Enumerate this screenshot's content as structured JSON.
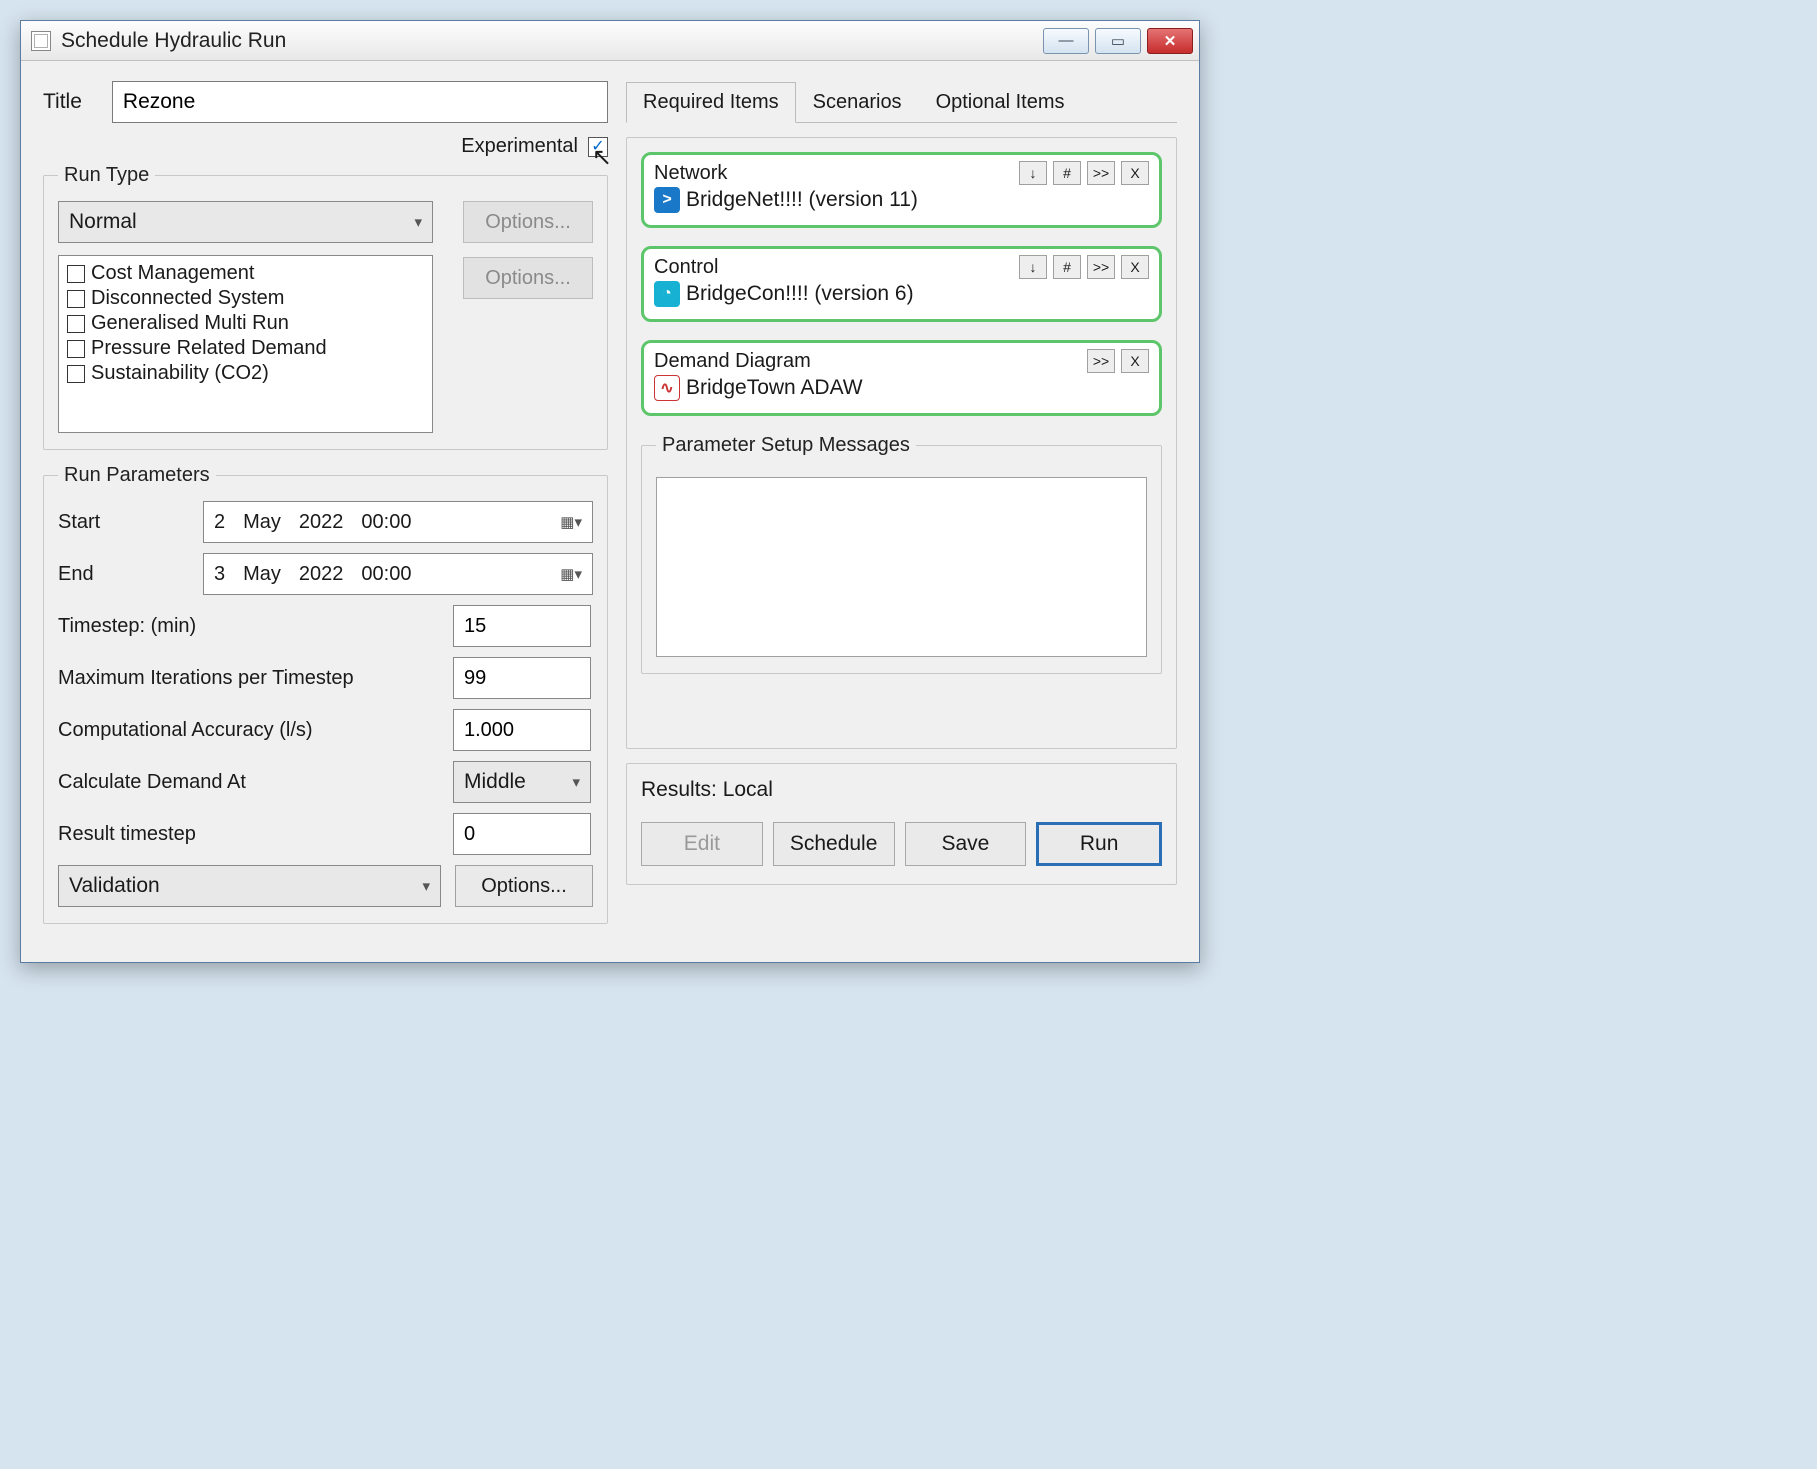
{
  "window": {
    "title": "Schedule Hydraulic Run"
  },
  "titleField": {
    "label": "Title",
    "value": "Rezone"
  },
  "experimental": {
    "label": "Experimental",
    "checked": true
  },
  "runType": {
    "legend": "Run Type",
    "value": "Normal",
    "options1": "Options...",
    "options2": "Options...",
    "checks": [
      "Cost Management",
      "Disconnected System",
      "Generalised Multi Run",
      "Pressure Related Demand",
      "Sustainability (CO2)"
    ]
  },
  "runParams": {
    "legend": "Run Parameters",
    "startLabel": "Start",
    "start": {
      "d": "2",
      "m": "May",
      "y": "2022",
      "t": "00:00"
    },
    "endLabel": "End",
    "end": {
      "d": "3",
      "m": "May",
      "y": "2022",
      "t": "00:00"
    },
    "timestepLabel": "Timestep: (min)",
    "timestep": "15",
    "maxIterLabel": "Maximum Iterations per Timestep",
    "maxIter": "99",
    "accuracyLabel": "Computational Accuracy (l/s)",
    "accuracy": "1.000",
    "calcAtLabel": "Calculate Demand At",
    "calcAt": "Middle",
    "resultTsLabel": "Result timestep",
    "resultTs": "0",
    "validation": "Validation",
    "options3": "Options..."
  },
  "tabs": {
    "t1": "Required Items",
    "t2": "Scenarios",
    "t3": "Optional Items"
  },
  "items": {
    "network": {
      "label": "Network",
      "value": "BridgeNet!!!! (version 11)"
    },
    "control": {
      "label": "Control",
      "value": "BridgeCon!!!! (version 6)"
    },
    "demand": {
      "label": "Demand Diagram",
      "value": "BridgeTown ADAW"
    }
  },
  "miniBtns": {
    "down": "↓",
    "hash": "#",
    "more": ">>",
    "close": "X"
  },
  "messages": {
    "legend": "Parameter Setup Messages"
  },
  "results": {
    "label": "Results: Local",
    "edit": "Edit",
    "schedule": "Schedule",
    "save": "Save",
    "run": "Run"
  }
}
